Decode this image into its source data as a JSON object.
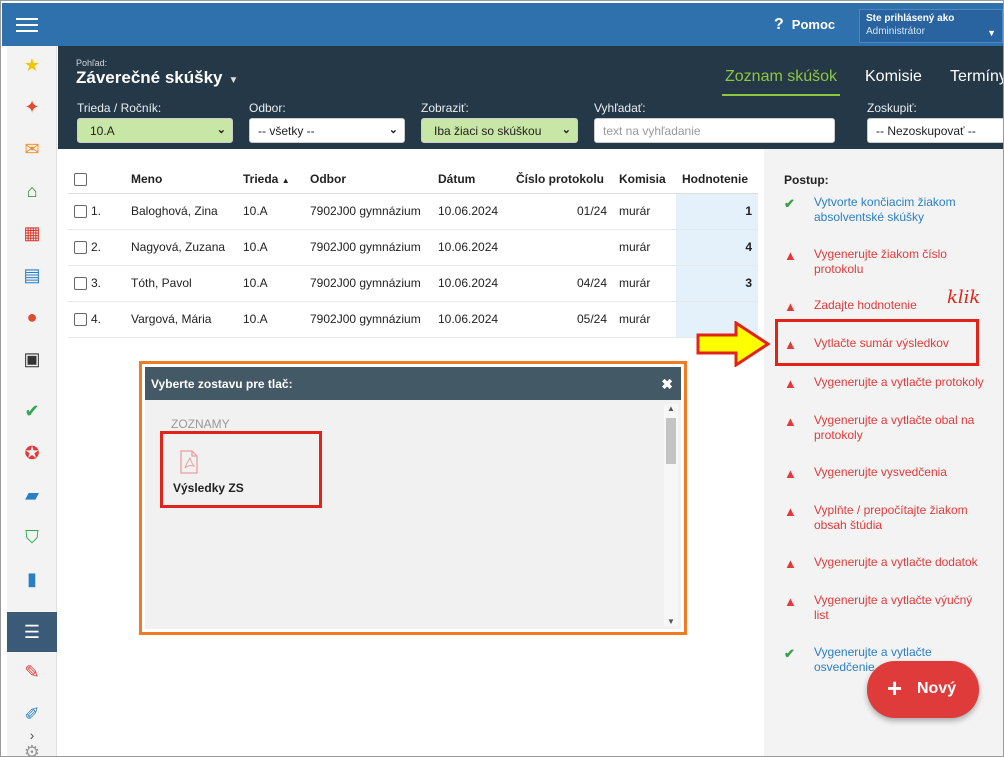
{
  "topbar": {
    "help_label": "Pomoc",
    "user_line1": "Ste prihlásený ako",
    "user_line2": "Administrátor"
  },
  "header": {
    "view_label": "Pohľad:",
    "title": "Záverečné skúšky",
    "tabs": [
      {
        "label": "Zoznam skúšok",
        "active": true
      },
      {
        "label": "Komisie",
        "active": false
      },
      {
        "label": "Termíny",
        "active": false
      }
    ],
    "filters": {
      "trieda_label": "Trieda / Ročník:",
      "trieda_value": "10.A",
      "odbor_label": "Odbor:",
      "odbor_value": "-- všetky --",
      "zobrazit_label": "Zobraziť:",
      "zobrazit_value": "Iba žiaci so skúškou",
      "vyhladat_label": "Vyhľadať:",
      "vyhladat_placeholder": "text na vyhľadanie",
      "zoskupit_label": "Zoskupiť:",
      "zoskupit_value": "-- Nezoskupovať --"
    }
  },
  "table": {
    "columns": [
      "Meno",
      "Trieda",
      "Odbor",
      "Dátum",
      "Číslo protokolu",
      "Komisia",
      "Hodnotenie"
    ],
    "sort_indicator": "▲",
    "rows": [
      {
        "num": "1.",
        "meno": "Baloghová, Zina",
        "trieda": "10.A",
        "odbor": "7902J00 gymnázium",
        "datum": "10.06.2024",
        "protokol": "01/24",
        "komisia": "murár",
        "hodnotenie": "1"
      },
      {
        "num": "2.",
        "meno": "Nagyová, Zuzana",
        "trieda": "10.A",
        "odbor": "7902J00 gymnázium",
        "datum": "10.06.2024",
        "protokol": "",
        "komisia": "murár",
        "hodnotenie": "4"
      },
      {
        "num": "3.",
        "meno": "Tóth, Pavol",
        "trieda": "10.A",
        "odbor": "7902J00 gymnázium",
        "datum": "10.06.2024",
        "protokol": "04/24",
        "komisia": "murár",
        "hodnotenie": "3"
      },
      {
        "num": "4.",
        "meno": "Vargová, Mária",
        "trieda": "10.A",
        "odbor": "7902J00 gymnázium",
        "datum": "10.06.2024",
        "protokol": "05/24",
        "komisia": "murár",
        "hodnotenie": ""
      }
    ]
  },
  "postup": {
    "title": "Postup:",
    "steps": [
      {
        "label": "Vytvorte končiacim žiakom absolventské skúšky",
        "status": "ok"
      },
      {
        "label": "Vygenerujte žiakom číslo protokolu",
        "status": "error"
      },
      {
        "label": "Zadajte hodnotenie",
        "status": "error"
      },
      {
        "label": "Vytlačte sumár výsledkov",
        "status": "error"
      },
      {
        "label": "Vygenerujte a vytlačte protokoly",
        "status": "error"
      },
      {
        "label": "Vygenerujte a vytlačte obal na protokoly",
        "status": "error"
      },
      {
        "label": "Vygenerujte vysvedčenia",
        "status": "error"
      },
      {
        "label": "Vyplňte / prepočítajte žiakom obsah štúdia",
        "status": "error"
      },
      {
        "label": "Vygenerujte a vytlačte dodatok",
        "status": "error"
      },
      {
        "label": "Vygenerujte a vytlačte výučný list",
        "status": "error"
      },
      {
        "label": "Vygenerujte a vytlačte osvedčenie",
        "status": "ok"
      }
    ]
  },
  "annotation": {
    "klik": "klik"
  },
  "new_button": {
    "label": "Nový"
  },
  "modal": {
    "title": "Vyberte zostavu pre tlač:",
    "section": "ZOZNAMY",
    "report_label": "Výsledky ZS"
  },
  "colors": {
    "topbar": "#2f71ad",
    "header": "#253847",
    "accent_green": "#8dc63f",
    "error_red": "#e03b3b",
    "highlight_red": "#e2231a",
    "modal_border": "#f07b23",
    "arrow_yellow": "#ffff00"
  },
  "sidebar_icons": [
    "star-icon",
    "magic-wand-icon",
    "mail-icon",
    "home-icon",
    "calendar-grid-icon",
    "notebook-icon",
    "user-icon",
    "calendar-icon",
    "check-circle-icon",
    "badge-icon",
    "briefcase-icon",
    "shield-check-icon",
    "bar-chart-icon",
    "book-icon",
    "chat-icon",
    "pen-icon",
    "chevron-right-icon",
    "gear-icon"
  ]
}
